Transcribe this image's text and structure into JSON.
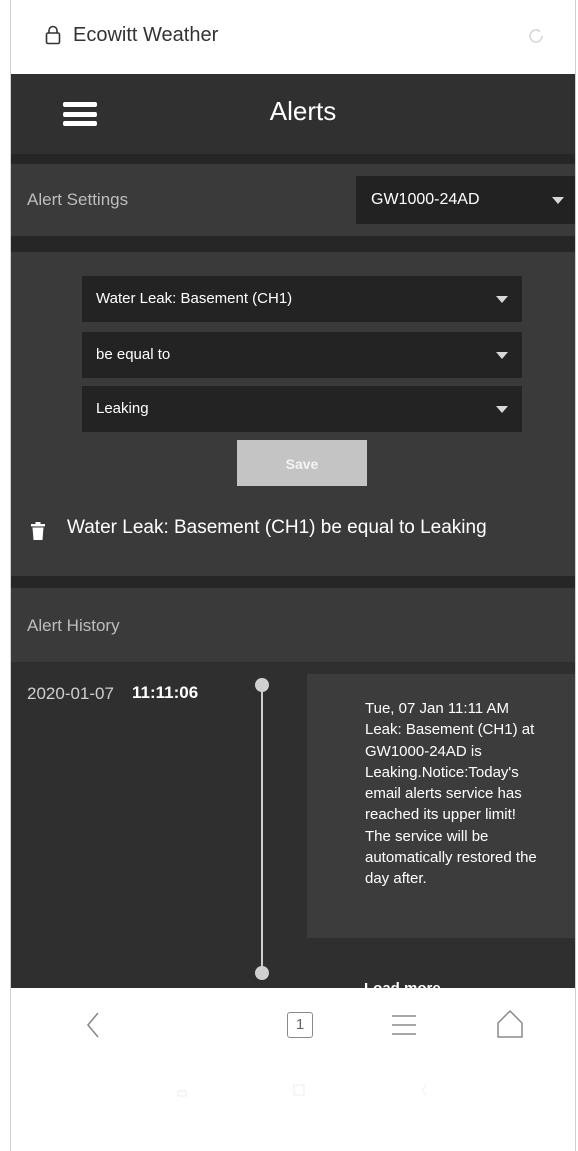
{
  "browser": {
    "title": "Ecowitt Weather"
  },
  "header": {
    "title": "Alerts"
  },
  "settings": {
    "label": "Alert Settings",
    "device": "GW1000-24AD"
  },
  "form": {
    "sensor": "Water Leak: Basement (CH1)",
    "condition": "be equal to",
    "value": "Leaking",
    "save_label": "Save"
  },
  "rule": {
    "text": "Water Leak: Basement (CH1) be equal to Leaking"
  },
  "history": {
    "label": "Alert History",
    "entry": {
      "date": "2020-01-07",
      "time": "11:11:06",
      "message_lines": [
        "Tue, 07 Jan 11:11 AM",
        "Leak: Basement (CH1) at",
        "GW1000-24AD is",
        "Leaking.Notice:Today's",
        "email alerts service has",
        "reached its upper limit!",
        "The service will be",
        "automatically restored the",
        "day after."
      ]
    },
    "load_more": "Load more"
  },
  "nav": {
    "tab_count": "1"
  },
  "colors": {
    "app_bg": "#2f2f2f",
    "panel_bg": "#3a3a3a",
    "dropdown_bg": "#232323",
    "save_bg": "#c4c4c4"
  }
}
